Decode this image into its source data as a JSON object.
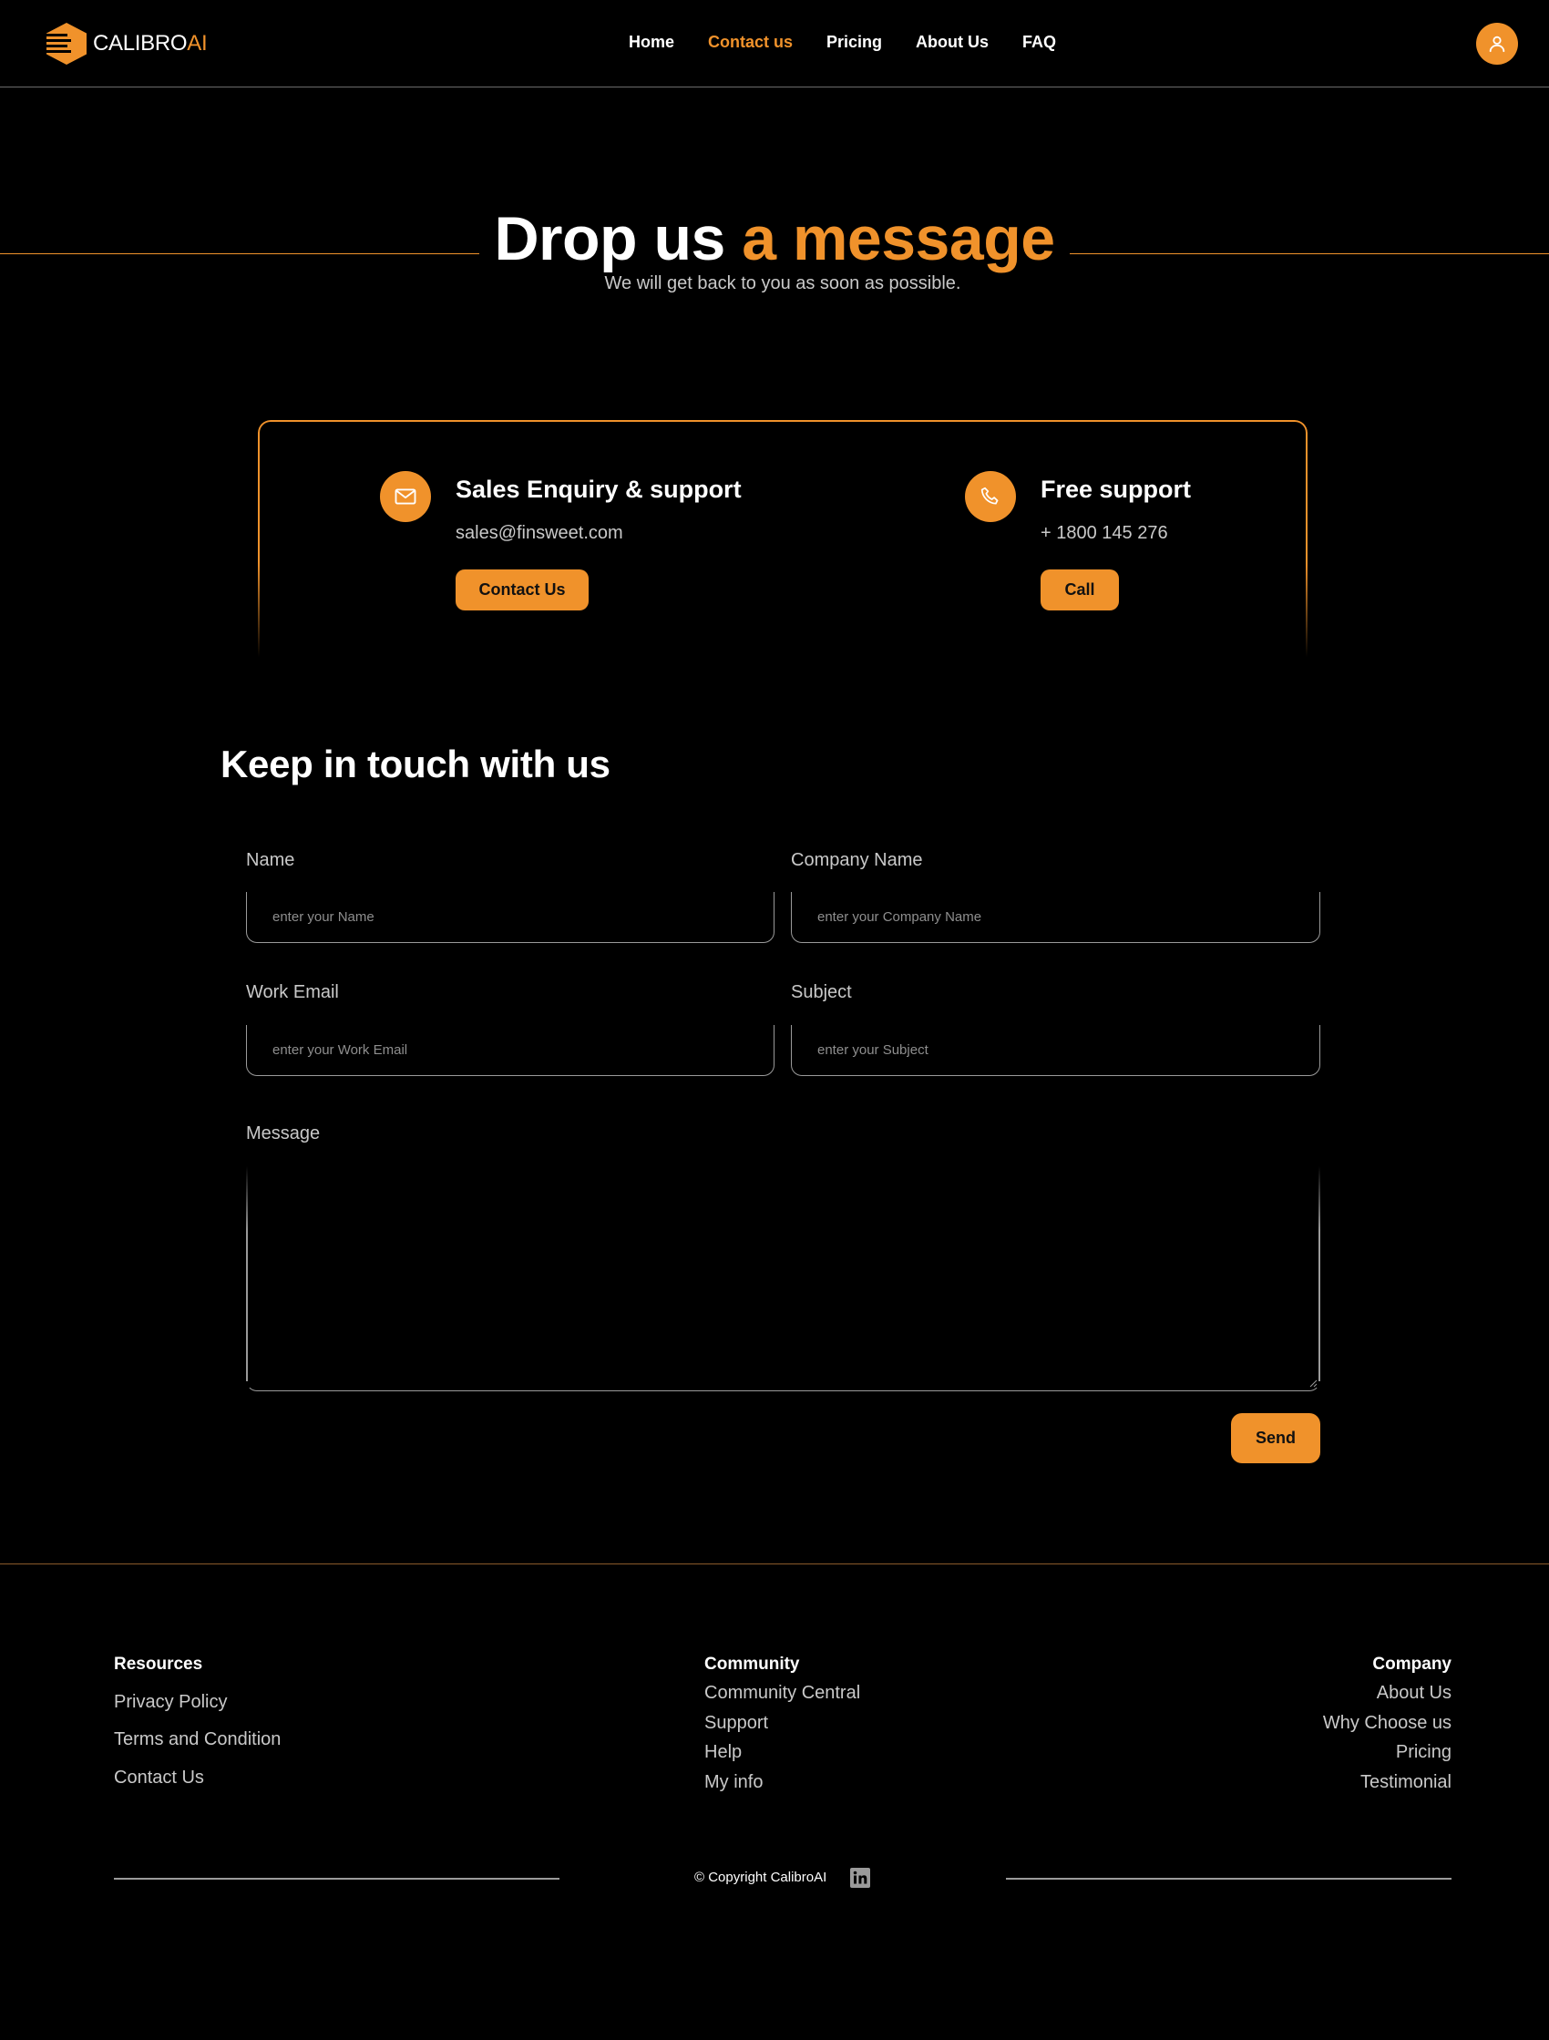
{
  "brand": {
    "name_main": "CALIBRO",
    "name_accent": "AI",
    "accent_color": "#f0922b"
  },
  "nav": {
    "items": [
      {
        "label": "Home",
        "active": false
      },
      {
        "label": "Contact us",
        "active": true
      },
      {
        "label": "Pricing",
        "active": false
      },
      {
        "label": "About Us",
        "active": false
      },
      {
        "label": "FAQ",
        "active": false
      }
    ],
    "avatar_icon": "user-icon"
  },
  "hero": {
    "title_white": "Drop us",
    "title_orange": "a message",
    "subtitle": "We will get back to you as soon as possible."
  },
  "support": {
    "sales": {
      "icon": "mail-icon",
      "title": "Sales Enquiry & support",
      "info": "sales@finsweet.com",
      "button": "Contact Us"
    },
    "free": {
      "icon": "phone-icon",
      "title": "Free support",
      "info": "+ 1800 145 276",
      "button": "Call"
    }
  },
  "form": {
    "heading": "Keep in touch with us",
    "name": {
      "label": "Name",
      "placeholder": "enter your Name"
    },
    "company": {
      "label": "Company Name",
      "placeholder": "enter your Company Name"
    },
    "email": {
      "label": "Work Email",
      "placeholder": "enter your Work Email"
    },
    "subject": {
      "label": "Subject",
      "placeholder": "enter your Subject"
    },
    "message": {
      "label": "Message"
    },
    "send": "Send"
  },
  "footer": {
    "resources": {
      "heading": "Resources",
      "links": [
        "Privacy Policy",
        "Terms and Condition",
        "Contact Us"
      ]
    },
    "community": {
      "heading": "Community",
      "links": [
        "Community Central",
        "Support",
        "Help",
        "My info"
      ]
    },
    "company": {
      "heading": "Company",
      "links": [
        "About Us",
        "Why Choose us",
        "Pricing",
        "Testimonial"
      ]
    },
    "copyright": "© Copyright CalibroAI",
    "social_icon": "linkedin-icon"
  }
}
